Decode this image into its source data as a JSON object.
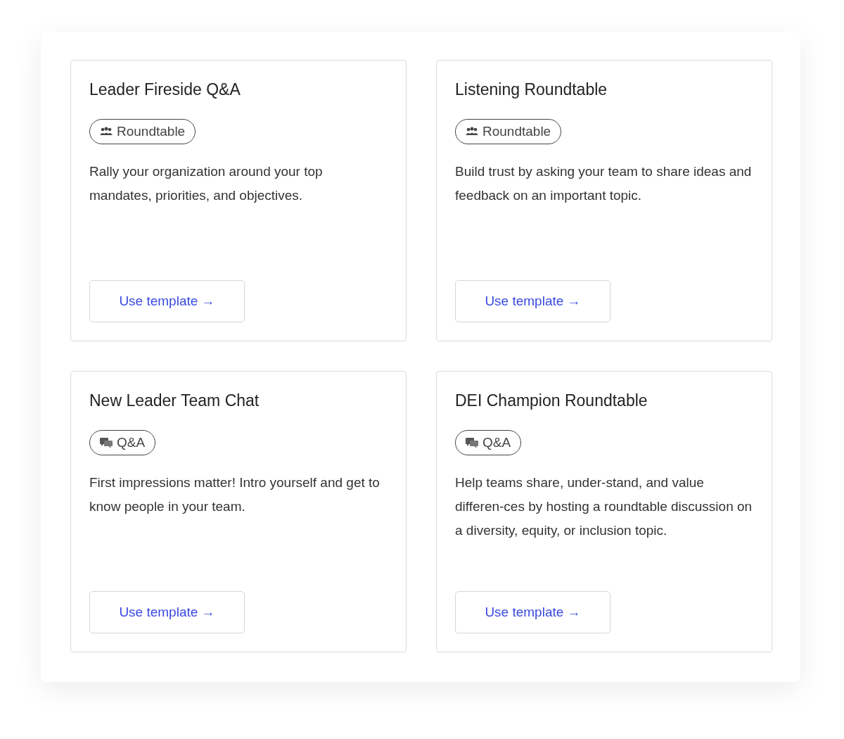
{
  "templates": [
    {
      "title": "Leader Fireside Q&A",
      "tag": {
        "kind": "roundtable",
        "label": "Roundtable"
      },
      "description": "Rally your organization around your top mandates, priorities, and objectives.",
      "button": "Use template →"
    },
    {
      "title": "Listening Roundtable",
      "tag": {
        "kind": "roundtable",
        "label": "Roundtable"
      },
      "description": "Build trust by asking your team to share ideas and feedback on an important topic.",
      "button": "Use template →"
    },
    {
      "title": "New Leader Team Chat",
      "tag": {
        "kind": "qa",
        "label": "Q&A"
      },
      "description": "First impressions matter! Intro yourself and get to know people in your team.",
      "button": "Use template →"
    },
    {
      "title": "DEI Champion Roundtable",
      "tag": {
        "kind": "qa",
        "label": "Q&A"
      },
      "description": "Help teams share, under-stand, and value differen-ces by hosting a roundtable discussion on a diversity, equity, or inclusion topic.",
      "button": "Use template →"
    }
  ]
}
